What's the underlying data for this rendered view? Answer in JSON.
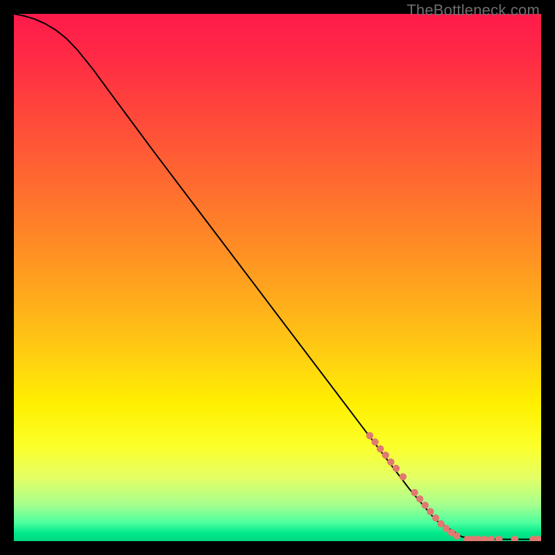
{
  "watermark": "TheBottleneck.com",
  "chart_data": {
    "type": "line",
    "title": "",
    "xlabel": "",
    "ylabel": "",
    "xlim": [
      0,
      100
    ],
    "ylim": [
      0,
      100
    ],
    "grid": false,
    "background_gradient": {
      "stops": [
        {
          "offset": 0.0,
          "color": "#ff1a4b"
        },
        {
          "offset": 0.08,
          "color": "#ff2a45"
        },
        {
          "offset": 0.2,
          "color": "#ff4a3a"
        },
        {
          "offset": 0.32,
          "color": "#ff6a30"
        },
        {
          "offset": 0.44,
          "color": "#ff8c25"
        },
        {
          "offset": 0.56,
          "color": "#ffb11a"
        },
        {
          "offset": 0.66,
          "color": "#ffd310"
        },
        {
          "offset": 0.74,
          "color": "#fff000"
        },
        {
          "offset": 0.82,
          "color": "#fcff2a"
        },
        {
          "offset": 0.88,
          "color": "#e4ff66"
        },
        {
          "offset": 0.93,
          "color": "#a7ff8d"
        },
        {
          "offset": 0.965,
          "color": "#4dffa0"
        },
        {
          "offset": 0.985,
          "color": "#00e88a"
        },
        {
          "offset": 1.0,
          "color": "#00d880"
        }
      ]
    },
    "series": [
      {
        "name": "curve",
        "color": "#000000",
        "x": [
          0,
          2,
          4,
          6,
          8,
          10,
          12,
          15,
          18,
          22,
          26,
          30,
          35,
          40,
          45,
          50,
          55,
          60,
          65,
          70,
          75,
          80,
          85,
          88,
          90,
          92,
          94,
          96,
          98,
          100
        ],
        "y": [
          100,
          99.6,
          99.0,
          98.1,
          96.9,
          95.3,
          93.2,
          89.5,
          85.4,
          80.0,
          74.6,
          69.3,
          62.7,
          56.1,
          49.5,
          42.9,
          36.3,
          29.7,
          23.1,
          16.5,
          9.9,
          4.0,
          0.8,
          0.4,
          0.35,
          0.35,
          0.35,
          0.35,
          0.35,
          0.35
        ]
      }
    ],
    "markers": {
      "color": "#e07a70",
      "radius": 5.2,
      "points": [
        {
          "x": 67.5,
          "y": 20.0
        },
        {
          "x": 68.5,
          "y": 18.8
        },
        {
          "x": 69.5,
          "y": 17.5
        },
        {
          "x": 70.5,
          "y": 16.3
        },
        {
          "x": 71.5,
          "y": 15.0
        },
        {
          "x": 72.5,
          "y": 13.8
        },
        {
          "x": 73.8,
          "y": 12.2
        },
        {
          "x": 76.0,
          "y": 9.2
        },
        {
          "x": 77.0,
          "y": 8.0
        },
        {
          "x": 78.0,
          "y": 6.8
        },
        {
          "x": 79.0,
          "y": 5.6
        },
        {
          "x": 80.0,
          "y": 4.4
        },
        {
          "x": 81.0,
          "y": 3.3
        },
        {
          "x": 82.0,
          "y": 2.4
        },
        {
          "x": 83.0,
          "y": 1.6
        },
        {
          "x": 84.0,
          "y": 1.0
        },
        {
          "x": 86.0,
          "y": 0.35
        },
        {
          "x": 87.0,
          "y": 0.35
        },
        {
          "x": 88.0,
          "y": 0.35
        },
        {
          "x": 89.2,
          "y": 0.35
        },
        {
          "x": 90.5,
          "y": 0.35
        },
        {
          "x": 92.0,
          "y": 0.35
        },
        {
          "x": 95.0,
          "y": 0.35
        },
        {
          "x": 98.5,
          "y": 0.35
        },
        {
          "x": 99.5,
          "y": 0.35
        }
      ]
    }
  }
}
